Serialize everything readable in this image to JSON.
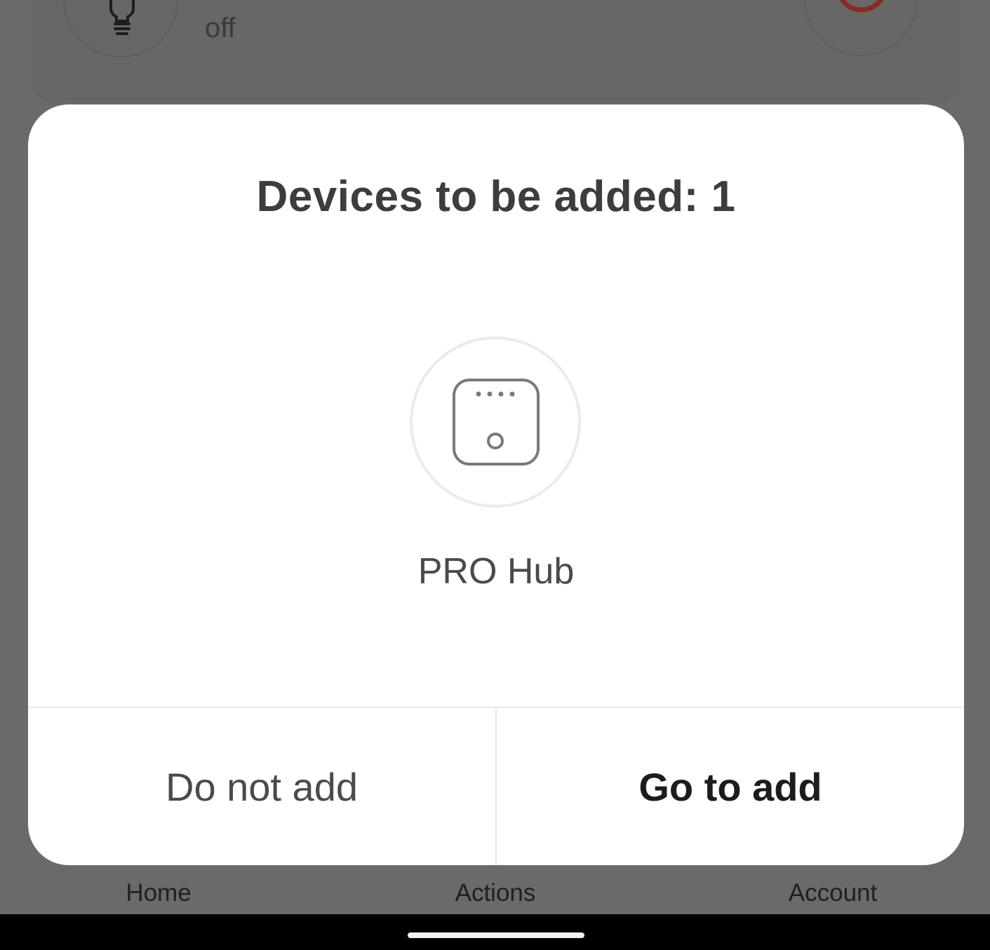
{
  "background": {
    "device_card": {
      "status": "off",
      "left_icon": "lightbulb-icon",
      "right_icon": "power-icon",
      "accent_color": "#b3261e"
    },
    "nav": {
      "items": [
        "Home",
        "Actions",
        "Account"
      ]
    }
  },
  "dialog": {
    "title": "Devices to be added: 1",
    "device": {
      "name": "PRO Hub",
      "icon": "hub-icon"
    },
    "buttons": {
      "cancel_label": "Do not add",
      "confirm_label": "Go to add"
    }
  }
}
